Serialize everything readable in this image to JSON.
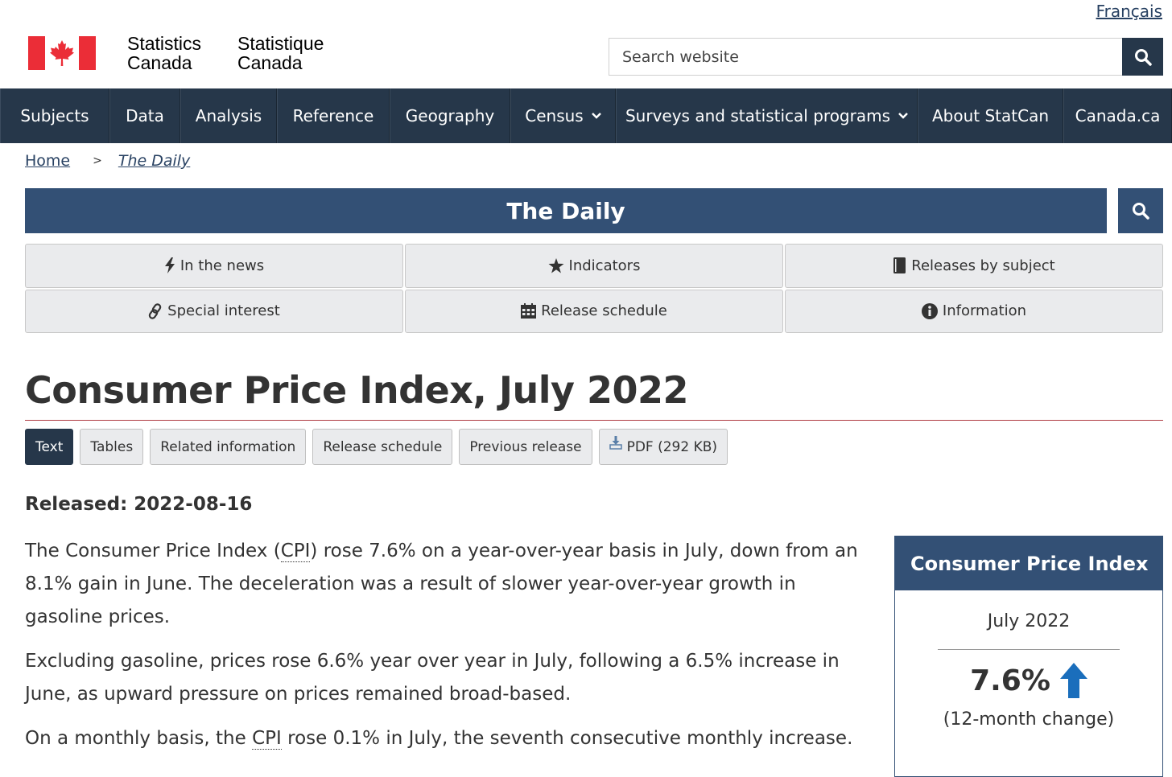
{
  "header": {
    "language_link": "Français",
    "signature_en": [
      "Statistics",
      "Canada"
    ],
    "signature_fr": [
      "Statistique",
      "Canada"
    ],
    "search_placeholder": "Search website",
    "flag_red": "#eb2d37"
  },
  "main_nav": [
    {
      "label": "Subjects",
      "dropdown": false
    },
    {
      "label": "Data",
      "dropdown": false
    },
    {
      "label": "Analysis",
      "dropdown": false
    },
    {
      "label": "Reference",
      "dropdown": false
    },
    {
      "label": "Geography",
      "dropdown": false
    },
    {
      "label": "Census",
      "dropdown": true
    },
    {
      "label": "Surveys and statistical programs",
      "dropdown": true
    },
    {
      "label": "About StatCan",
      "dropdown": false
    },
    {
      "label": "Canada.ca",
      "dropdown": false
    }
  ],
  "breadcrumb": {
    "home": "Home",
    "separator": ">",
    "current": "The Daily"
  },
  "daily": {
    "title": "The Daily",
    "links": [
      {
        "label": "In the news",
        "icon": "bolt-icon"
      },
      {
        "label": "Indicators",
        "icon": "star-icon"
      },
      {
        "label": "Releases by subject",
        "icon": "book-icon"
      },
      {
        "label": "Special interest",
        "icon": "link-icon"
      },
      {
        "label": "Release schedule",
        "icon": "calendar-icon"
      },
      {
        "label": "Information",
        "icon": "info-icon"
      }
    ]
  },
  "article": {
    "title": "Consumer Price Index, July 2022",
    "tabs": [
      "Text",
      "Tables",
      "Related information",
      "Release schedule",
      "Previous release",
      "PDF (292 KB)"
    ],
    "released": "Released: 2022-08-16",
    "p1": {
      "a": "The Consumer Price Index (",
      "abbr": "CPI",
      "b": ") rose 7.6% on a year-over-year basis in July, down from an 8.1% gain in June. The deceleration was a result of slower year-over-year growth in gasoline prices."
    },
    "p2": "Excluding gasoline, prices rose 6.6% year over year in July, following a 6.5% increase in June, as upward pressure on prices remained broad-based.",
    "p3": {
      "a": "On a monthly basis, the ",
      "abbr": "CPI",
      "b": " rose 0.1% in July, the seventh consecutive monthly increase."
    }
  },
  "indicator": {
    "title": "Consumer Price Index",
    "period": "July 2022",
    "value": "7.6%",
    "direction": "up",
    "caption": "(12-month change)",
    "arrow_color": "#1a6ebc"
  },
  "colors": {
    "nav_bg": "#26374a",
    "daily_bg": "#335075",
    "accent_rule": "#af3c43"
  }
}
